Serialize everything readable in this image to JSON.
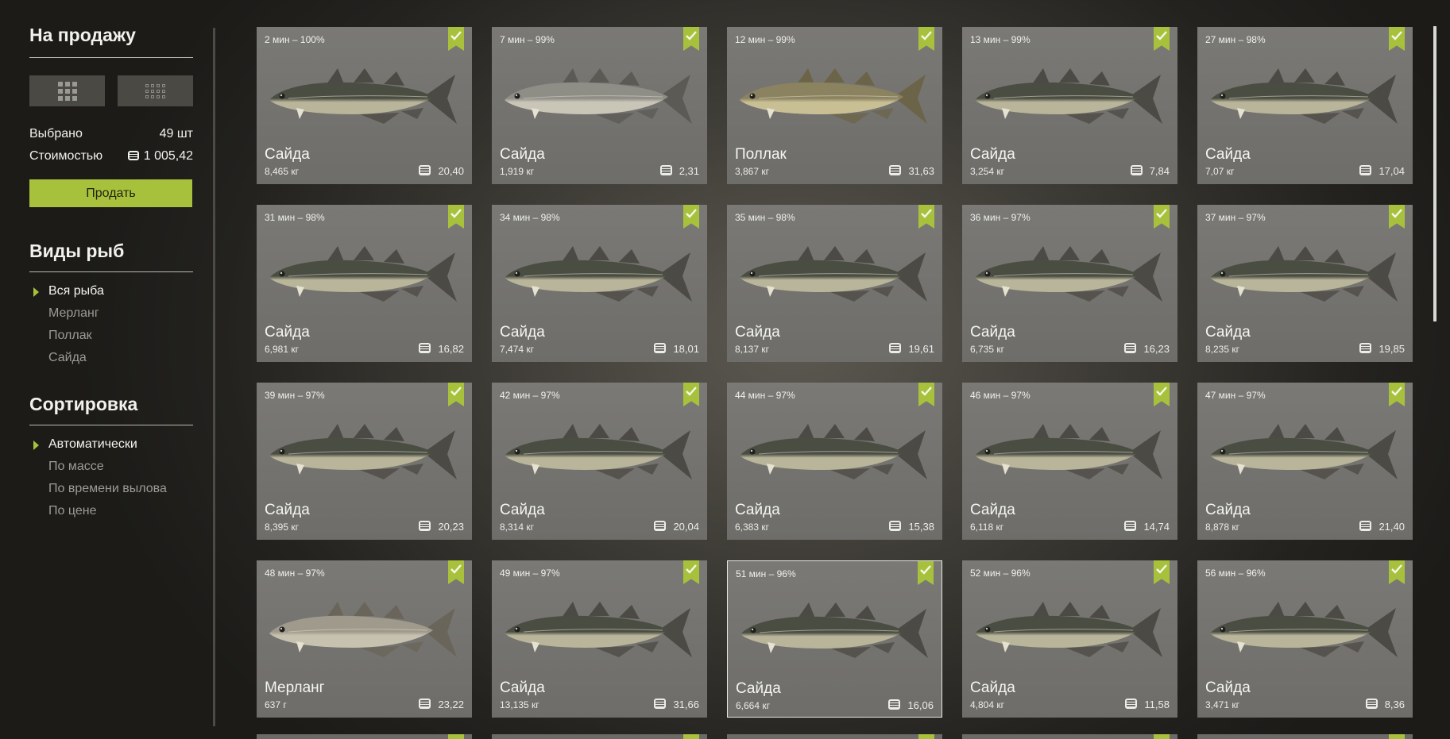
{
  "sidebar": {
    "for_sale_title": "На продажу",
    "selected_label": "Выбрано",
    "selected_value": "49 шт",
    "cost_label": "Стоимостью",
    "cost_value": "1 005,42",
    "sell_button": "Продать",
    "species_title": "Виды рыб",
    "species": [
      "Вся рыба",
      "Мерланг",
      "Поллак",
      "Сайда"
    ],
    "species_active": 0,
    "sort_title": "Сортировка",
    "sort_options": [
      "Автоматически",
      "По массе",
      "По времени вылова",
      "По цене"
    ],
    "sort_active": 0
  },
  "colors": {
    "accent": "#a8c13c",
    "card_bg": "#75746f",
    "fish_saithe": "#4a4d42",
    "fish_pollack": "#8b8260",
    "fish_whiting": "#c7c1b0"
  },
  "fish": [
    {
      "time": "2 мин – 100%",
      "name": "Сайда",
      "weight": "8,465 кг",
      "price": "20,40",
      "kind": "saithe"
    },
    {
      "time": "7 мин – 99%",
      "name": "Сайда",
      "weight": "1,919 кг",
      "price": "2,31",
      "kind": "saithe-light"
    },
    {
      "time": "12 мин – 99%",
      "name": "Поллак",
      "weight": "3,867 кг",
      "price": "31,63",
      "kind": "pollack"
    },
    {
      "time": "13 мин – 99%",
      "name": "Сайда",
      "weight": "3,254 кг",
      "price": "7,84",
      "kind": "saithe"
    },
    {
      "time": "27 мин – 98%",
      "name": "Сайда",
      "weight": "7,07 кг",
      "price": "17,04",
      "kind": "saithe"
    },
    {
      "time": "31 мин – 98%",
      "name": "Сайда",
      "weight": "6,981 кг",
      "price": "16,82",
      "kind": "saithe"
    },
    {
      "time": "34 мин – 98%",
      "name": "Сайда",
      "weight": "7,474 кг",
      "price": "18,01",
      "kind": "saithe"
    },
    {
      "time": "35 мин – 98%",
      "name": "Сайда",
      "weight": "8,137 кг",
      "price": "19,61",
      "kind": "saithe"
    },
    {
      "time": "36 мин – 97%",
      "name": "Сайда",
      "weight": "6,735 кг",
      "price": "16,23",
      "kind": "saithe"
    },
    {
      "time": "37 мин – 97%",
      "name": "Сайда",
      "weight": "8,235 кг",
      "price": "19,85",
      "kind": "saithe"
    },
    {
      "time": "39 мин – 97%",
      "name": "Сайда",
      "weight": "8,395 кг",
      "price": "20,23",
      "kind": "saithe"
    },
    {
      "time": "42 мин – 97%",
      "name": "Сайда",
      "weight": "8,314 кг",
      "price": "20,04",
      "kind": "saithe"
    },
    {
      "time": "44 мин – 97%",
      "name": "Сайда",
      "weight": "6,383 кг",
      "price": "15,38",
      "kind": "saithe"
    },
    {
      "time": "46 мин – 97%",
      "name": "Сайда",
      "weight": "6,118 кг",
      "price": "14,74",
      "kind": "saithe"
    },
    {
      "time": "47 мин – 97%",
      "name": "Сайда",
      "weight": "8,878 кг",
      "price": "21,40",
      "kind": "saithe"
    },
    {
      "time": "48 мин – 97%",
      "name": "Мерланг",
      "weight": "637 г",
      "price": "23,22",
      "kind": "whiting"
    },
    {
      "time": "49 мин – 97%",
      "name": "Сайда",
      "weight": "13,135 кг",
      "price": "31,66",
      "kind": "saithe"
    },
    {
      "time": "51 мин – 96%",
      "name": "Сайда",
      "weight": "6,664 кг",
      "price": "16,06",
      "kind": "saithe",
      "outlined": true
    },
    {
      "time": "52 мин – 96%",
      "name": "Сайда",
      "weight": "4,804 кг",
      "price": "11,58",
      "kind": "saithe"
    },
    {
      "time": "56 мин – 96%",
      "name": "Сайда",
      "weight": "3,471 кг",
      "price": "8,36",
      "kind": "saithe"
    }
  ]
}
